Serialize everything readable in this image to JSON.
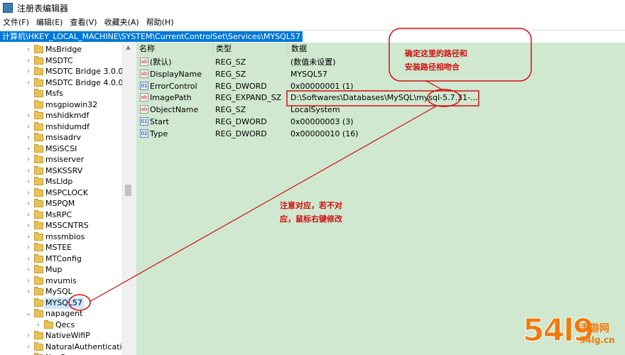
{
  "window": {
    "title": "注册表编辑器",
    "app_icon": "regedit-icon"
  },
  "menu": [
    "文件(F)",
    "编辑(E)",
    "查看(V)",
    "收藏夹(A)",
    "帮助(H)"
  ],
  "address": "计算机\\HKEY_LOCAL_MACHINE\\SYSTEM\\CurrentControlSet\\Services\\MYSQL57",
  "tree": {
    "items": [
      {
        "label": "MsBridge",
        "level": 0,
        "expander": ">"
      },
      {
        "label": "MSDTC",
        "level": 0,
        "expander": ">"
      },
      {
        "label": "MSDTC Bridge 3.0.0.0",
        "level": 0,
        "expander": ">"
      },
      {
        "label": "MSDTC Bridge 4.0.0.0",
        "level": 0,
        "expander": ">"
      },
      {
        "label": "Msfs",
        "level": 0,
        "expander": ""
      },
      {
        "label": "msgpiowin32",
        "level": 0,
        "expander": ""
      },
      {
        "label": "mshidkmdf",
        "level": 0,
        "expander": ">"
      },
      {
        "label": "mshidumdf",
        "level": 0,
        "expander": ">"
      },
      {
        "label": "msisadrv",
        "level": 0,
        "expander": ">"
      },
      {
        "label": "MSiSCSI",
        "level": 0,
        "expander": ">"
      },
      {
        "label": "msiserver",
        "level": 0,
        "expander": ">"
      },
      {
        "label": "MSKSSRV",
        "level": 0,
        "expander": ">"
      },
      {
        "label": "MsLldp",
        "level": 0,
        "expander": ">"
      },
      {
        "label": "MSPCLOCK",
        "level": 0,
        "expander": ">"
      },
      {
        "label": "MSPQM",
        "level": 0,
        "expander": ">"
      },
      {
        "label": "MsRPC",
        "level": 0,
        "expander": ">"
      },
      {
        "label": "MSSCNTRS",
        "level": 0,
        "expander": ">"
      },
      {
        "label": "mssmbios",
        "level": 0,
        "expander": ">"
      },
      {
        "label": "MSTEE",
        "level": 0,
        "expander": ">"
      },
      {
        "label": "MTConfig",
        "level": 0,
        "expander": ">"
      },
      {
        "label": "Mup",
        "level": 0,
        "expander": ">"
      },
      {
        "label": "mvumis",
        "level": 0,
        "expander": ">"
      },
      {
        "label": "MySQL",
        "level": 0,
        "expander": ">"
      },
      {
        "label": "MYSQL57",
        "level": 0,
        "expander": "",
        "selected": true
      },
      {
        "label": "napagent",
        "level": 0,
        "expander": "v"
      },
      {
        "label": "Qecs",
        "level": 1,
        "expander": ">"
      },
      {
        "label": "NativeWifiP",
        "level": 0,
        "expander": ">"
      },
      {
        "label": "NaturalAuthentication",
        "level": 0,
        "expander": ">"
      },
      {
        "label": "NcaSvc",
        "level": 0,
        "expander": ">"
      }
    ]
  },
  "values": {
    "columns": [
      "名称",
      "类型",
      "数据"
    ],
    "rows": [
      {
        "icon": "sz",
        "name": "(默认)",
        "type": "REG_SZ",
        "data": "(数值未设置)"
      },
      {
        "icon": "sz",
        "name": "DisplayName",
        "type": "REG_SZ",
        "data": "MYSQL57"
      },
      {
        "icon": "dword",
        "name": "ErrorControl",
        "type": "REG_DWORD",
        "data": "0x00000001 (1)"
      },
      {
        "icon": "sz",
        "name": "ImagePath",
        "type": "REG_EXPAND_SZ",
        "data": "D:\\Softwares\\Databases\\MySQL\\mysql-5.7.31-..."
      },
      {
        "icon": "sz",
        "name": "ObjectName",
        "type": "REG_SZ",
        "data": "LocalSystem"
      },
      {
        "icon": "dword",
        "name": "Start",
        "type": "REG_DWORD",
        "data": "0x00000003 (3)"
      },
      {
        "icon": "dword",
        "name": "Type",
        "type": "REG_DWORD",
        "data": "0x00000010 (16)"
      }
    ]
  },
  "annotations": {
    "note_top_line1": "确定这里的路径和",
    "note_top_line2": "安装路径相吻合",
    "note_mid_line1": "注意对应，若不对",
    "note_mid_line2": "应，鼠标右键修改",
    "color": "#d01010"
  },
  "watermark": {
    "big": "54l9",
    "top": "手游网",
    "bottom": "54lg.cn",
    "color": "#f07a10"
  },
  "colors": {
    "values_bg": "#cfe8cf",
    "selection": "#0078d7"
  }
}
